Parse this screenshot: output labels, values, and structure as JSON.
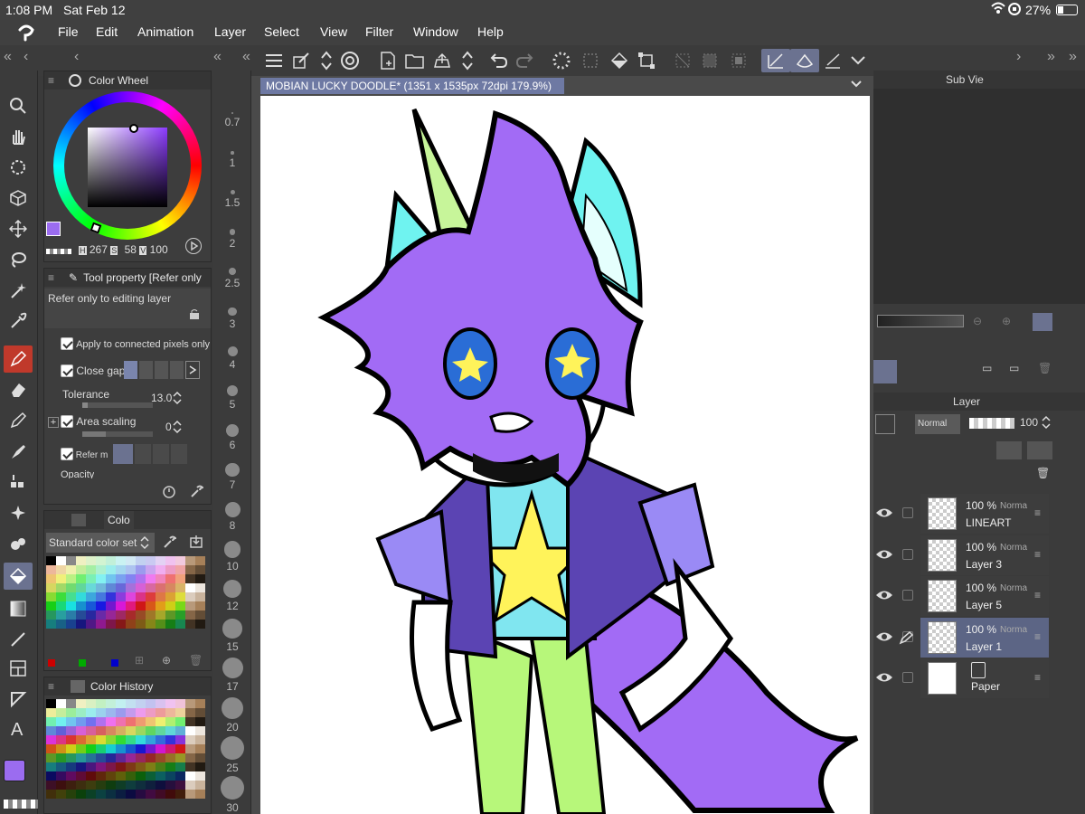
{
  "status": {
    "time": "1:08 PM",
    "date": "Sat Feb 12",
    "battery": "27%"
  },
  "menu": [
    "File",
    "Edit",
    "Animation",
    "Layer",
    "Select",
    "View",
    "Filter",
    "Window",
    "Help"
  ],
  "document": {
    "tab_title": "MOBIAN LUCKY DOODLE* (1351 x 1535px 72dpi 179.9%)"
  },
  "color_wheel": {
    "title": "Color Wheel",
    "h_label": "H",
    "h": "267",
    "s_label": "S",
    "s": "58",
    "v_label": "V",
    "v": "100",
    "main_color": "#9b6cf0"
  },
  "tool_property": {
    "title": "Tool property [Refer only",
    "subtitle": "Refer only to editing layer",
    "apply_connected": "Apply to connected pixels only",
    "close_gap": "Close gap",
    "tolerance_label": "Tolerance",
    "tolerance_value": "13.0",
    "area_scaling": "Area scaling",
    "area_scaling_value": "0",
    "refer_multiple": "Refer m",
    "opacity": "Opacity"
  },
  "color_set": {
    "tab": "Colo",
    "selector": "Standard color set"
  },
  "color_history": {
    "title": "Color History"
  },
  "brush_sizes": [
    "0.7",
    "1",
    "1.5",
    "2",
    "2.5",
    "3",
    "4",
    "5",
    "6",
    "7",
    "8",
    "10",
    "12",
    "15",
    "17",
    "20",
    "25",
    "30"
  ],
  "sub_view": {
    "title": "Sub Vie"
  },
  "layer_panel": {
    "title": "Layer",
    "blend_mode": "Normal",
    "opacity": "100",
    "layers": [
      {
        "percent": "100 %",
        "mode": "Norma",
        "name": "LINEART"
      },
      {
        "percent": "100 %",
        "mode": "Norma",
        "name": "Layer 3"
      },
      {
        "percent": "100 %",
        "mode": "Norma",
        "name": "Layer 5"
      },
      {
        "percent": "100 %",
        "mode": "Norma",
        "name": "Layer 1"
      },
      {
        "percent": "",
        "mode": "",
        "name": "Paper"
      }
    ]
  },
  "colors": {
    "accent": "#6e79a3",
    "panel": "#3d3d3d",
    "selected_tool": "#6b7290"
  }
}
